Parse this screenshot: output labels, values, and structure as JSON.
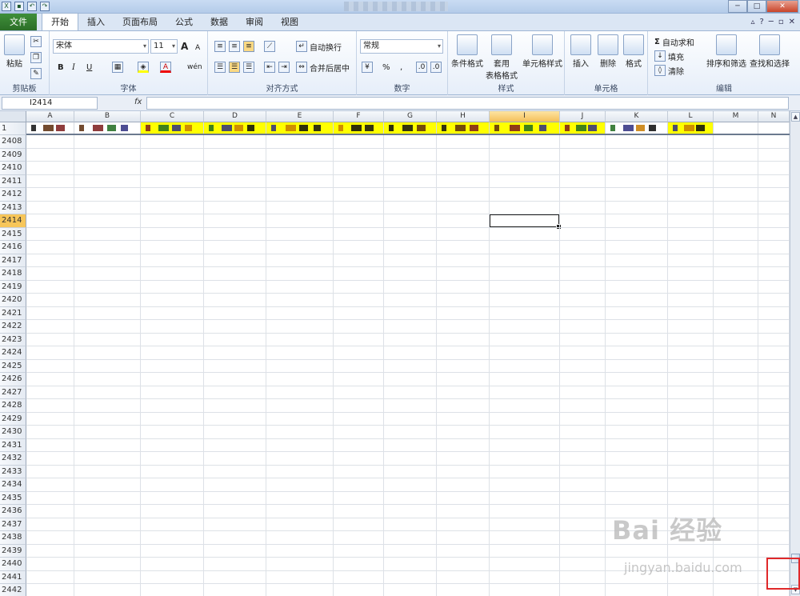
{
  "window": {
    "min": "─",
    "max": "□",
    "close": "✕"
  },
  "tabs": [
    {
      "label": "文件",
      "cls": "file"
    },
    {
      "label": "开始",
      "cls": "active"
    },
    {
      "label": "插入"
    },
    {
      "label": "页面布局"
    },
    {
      "label": "公式"
    },
    {
      "label": "数据"
    },
    {
      "label": "审阅"
    },
    {
      "label": "视图"
    }
  ],
  "ribbon": {
    "clipboard": {
      "paste": "粘贴",
      "label": "剪贴板"
    },
    "font": {
      "name": "宋体",
      "size": "11",
      "bold": "B",
      "italic": "I",
      "underline": "U",
      "grow": "A",
      "shrink": "A",
      "wen": "wén",
      "label": "字体"
    },
    "align": {
      "wrap": "自动换行",
      "merge": "合并后居中",
      "label": "对齐方式"
    },
    "number": {
      "format": "常规",
      "percent": "%",
      "comma": ",",
      "label": "数字"
    },
    "styles": {
      "cond": "条件格式",
      "table1": "套用",
      "table2": "表格格式",
      "cell": "单元格样式",
      "label": "样式"
    },
    "cells": {
      "insert": "插入",
      "delete": "删除",
      "format": "格式",
      "label": "单元格"
    },
    "edit": {
      "autosum": "自动求和",
      "fill": "填充",
      "clear": "清除",
      "sort": "排序和筛选",
      "find": "查找和选择",
      "label": "编辑"
    }
  },
  "formula": {
    "namebox": "I2414",
    "fx": "fx",
    "value": ""
  },
  "columns": [
    "A",
    "B",
    "C",
    "D",
    "E",
    "F",
    "G",
    "H",
    "I",
    "J",
    "K",
    "L",
    "M",
    "N"
  ],
  "selected_column": "I",
  "header_row": "1",
  "rows": [
    "2408",
    "2409",
    "2410",
    "2411",
    "2412",
    "2413",
    "2414",
    "2415",
    "2416",
    "2417",
    "2418",
    "2419",
    "2420",
    "2421",
    "2422",
    "2423",
    "2424",
    "2425",
    "2426",
    "2427",
    "2428",
    "2429",
    "2430",
    "2431",
    "2432",
    "2433",
    "2434",
    "2435",
    "2436",
    "2437",
    "2438",
    "2439",
    "2440",
    "2441",
    "2442"
  ],
  "selected_row": "2414",
  "colors": {
    "highlight": "#ffff00",
    "selected": "#f7c65a",
    "annotation": "#e0282a"
  },
  "watermark": {
    "brand": "Bai 经验",
    "url": "jingyan.baidu.com"
  }
}
